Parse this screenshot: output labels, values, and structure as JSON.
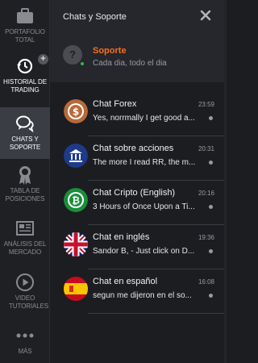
{
  "sidebar": {
    "items": [
      {
        "label": "PORTAFOLIO TOTAL",
        "icon": "briefcase-icon"
      },
      {
        "label": "HISTORIAL DE TRADING",
        "icon": "history-icon"
      },
      {
        "label": "CHATS Y SOPORTE",
        "icon": "chat-bubbles-icon"
      },
      {
        "label": "TABLA DE POSICIONES",
        "icon": "award-icon"
      },
      {
        "label": "ANÁLISIS DEL MERCADO",
        "icon": "newspaper-icon"
      },
      {
        "label": "VIDEO TUTORIALES",
        "icon": "play-icon"
      },
      {
        "label": "MÁS",
        "icon": "more-icon"
      }
    ],
    "plus": "+"
  },
  "header": {
    "title": "Chats y Soporte",
    "close_icon": "close-icon",
    "support": {
      "avatar_glyph": "?",
      "name": "Soporte",
      "status": "Cada dia, todo el dia"
    }
  },
  "chats": [
    {
      "name": "Chat Forex",
      "time": "23:59",
      "message": "Yes, norrmally I get good a...",
      "icon": "dollar-coin-icon"
    },
    {
      "name": "Chat sobre acciones",
      "time": "20:31",
      "message": "The more I read RR, the m...",
      "icon": "bank-icon"
    },
    {
      "name": "Chat Cripto (English)",
      "time": "20:16",
      "message": "3 Hours of Once Upon a Ti...",
      "icon": "bitcoin-icon"
    },
    {
      "name": "Chat en inglés",
      "time": "19:36",
      "message": "Sandor B, - Just click on D...",
      "icon": "uk-flag-icon"
    },
    {
      "name": "Chat en español",
      "time": "16:08",
      "message": "segun me dijeron en el so...",
      "icon": "spain-flag-icon"
    }
  ],
  "colors": {
    "accent": "#f37021",
    "online": "#39b54a",
    "active_nav": "#3b3d44"
  }
}
